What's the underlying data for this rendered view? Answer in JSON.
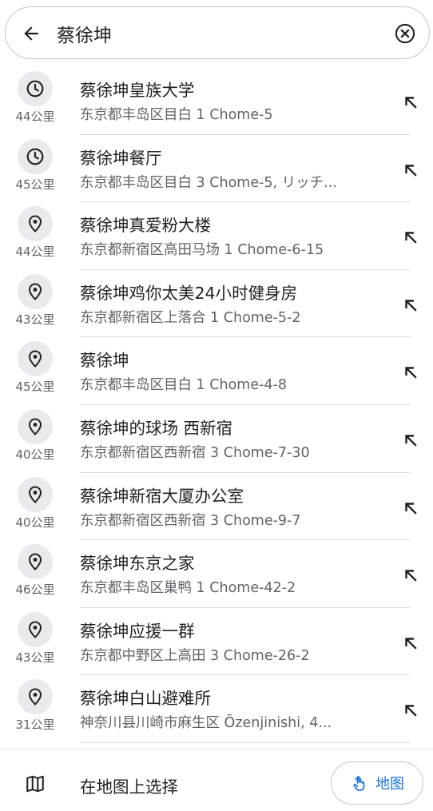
{
  "search": {
    "query": "蔡徐坤",
    "back_icon": "arrow-back-icon",
    "clear_icon": "clear-circle-icon"
  },
  "results": [
    {
      "icon": "history-icon",
      "distance": "44公里",
      "title": "蔡徐坤皇族大学",
      "address": "东京都丰岛区目白 1 Chome-5"
    },
    {
      "icon": "history-icon",
      "distance": "45公里",
      "title": "蔡徐坤餐厅",
      "address": "东京都丰岛区目白 3 Chome-5, リッチ..."
    },
    {
      "icon": "place-pin-icon",
      "distance": "44公里",
      "title": "蔡徐坤真爱粉大楼",
      "address": "东京都新宿区高田马场 1 Chome-6-15"
    },
    {
      "icon": "place-pin-icon",
      "distance": "43公里",
      "title": "蔡徐坤鸡你太美24小时健身房",
      "address": "东京都新宿区上落合 1 Chome-5-2"
    },
    {
      "icon": "place-pin-icon",
      "distance": "45公里",
      "title": "蔡徐坤",
      "address": "东京都丰岛区目白 1 Chome-4-8"
    },
    {
      "icon": "place-pin-icon",
      "distance": "40公里",
      "title": "蔡徐坤的球场 西新宿",
      "address": "东京都新宿区西新宿 3 Chome-7-30"
    },
    {
      "icon": "place-pin-icon",
      "distance": "40公里",
      "title": "蔡徐坤新宿大厦办公室",
      "address": "东京都新宿区西新宿 3 Chome-9-7"
    },
    {
      "icon": "place-pin-icon",
      "distance": "46公里",
      "title": "蔡徐坤东京之家",
      "address": "东京都丰岛区巢鸭 1 Chome-42-2"
    },
    {
      "icon": "place-pin-icon",
      "distance": "43公里",
      "title": "蔡徐坤应援一群",
      "address": "东京都中野区上高田 3 Chome-26-2"
    },
    {
      "icon": "place-pin-icon",
      "distance": "31公里",
      "title": "蔡徐坤白山避难所",
      "address": "神奈川县川崎市麻生区 Ōzenjinishi, 4..."
    }
  ],
  "fill_query_icon": "north-west-arrow-icon",
  "bottom": {
    "map_icon": "folded-map-icon",
    "pick_on_map_label": "在地图上选择",
    "map_button_icon": "touch-hand-icon",
    "map_button_label": "地图"
  },
  "colors": {
    "accent": "#1a73e8",
    "text_primary": "#202124",
    "text_secondary": "#5f6368",
    "icon_bg": "#e8eaed",
    "divider": "#dadce0"
  }
}
